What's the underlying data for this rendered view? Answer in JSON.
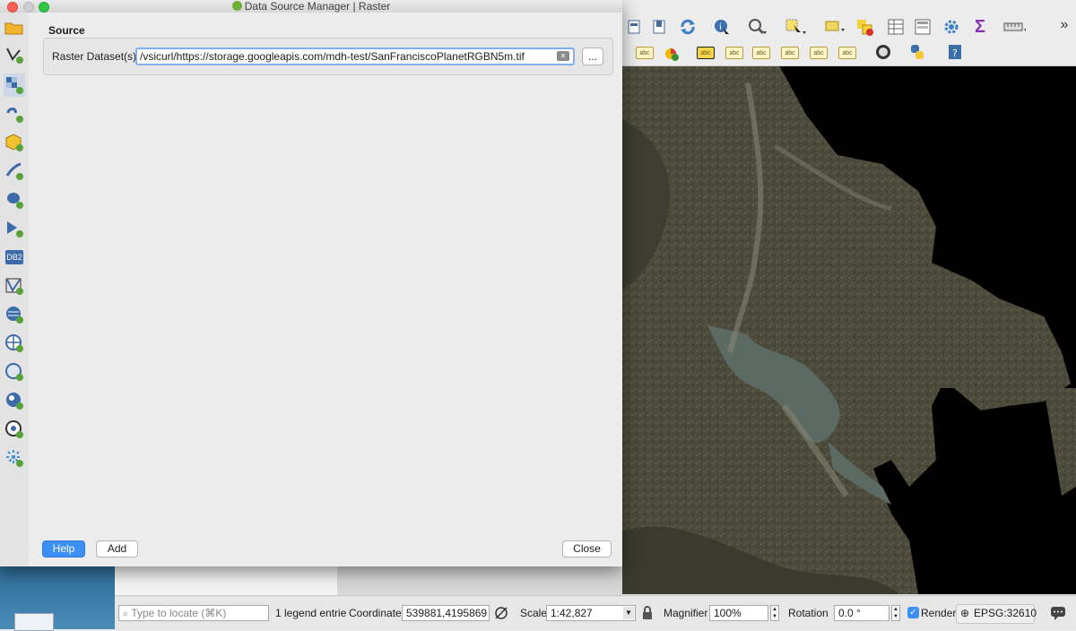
{
  "dialog": {
    "title": "Data Source Manager | Raster",
    "section_title": "Source",
    "raster_label": "Raster Dataset(s)",
    "raster_value": "/vsicurl/https://storage.googleapis.com/mdh-test/SanFranciscoPlanetRGBN5m.tif",
    "browse_label": "...",
    "help_label": "Help",
    "add_label": "Add",
    "close_label": "Close"
  },
  "sidebar": {
    "items": [
      {
        "icon": "folder-open-icon"
      },
      {
        "icon": "add-vector-layer-icon"
      },
      {
        "icon": "add-raster-layer-icon"
      },
      {
        "icon": "add-mesh-layer-icon"
      },
      {
        "icon": "add-geopackage-icon"
      },
      {
        "icon": "add-spatialite-icon"
      },
      {
        "icon": "add-postgis-icon"
      },
      {
        "icon": "add-mssql-icon"
      },
      {
        "icon": "add-db2-icon",
        "text": "DB2"
      },
      {
        "icon": "add-virtual-layer-icon"
      },
      {
        "icon": "add-wms-icon"
      },
      {
        "icon": "add-wcs-icon"
      },
      {
        "icon": "add-wfs-icon"
      },
      {
        "icon": "add-arcgis-map-icon"
      },
      {
        "icon": "add-arcgis-feature-icon"
      },
      {
        "icon": "add-delimited-text-icon"
      }
    ]
  },
  "statusbar": {
    "locate_placeholder": "Type to locate (⌘K)",
    "legend_text": "1 legend entrie",
    "coordinate_label": "Coordinate",
    "coordinate_value": "539881,4195869",
    "scale_label": "Scale",
    "scale_value": "1:42,827",
    "magnifier_label": "Magnifier",
    "magnifier_value": "100%",
    "rotation_label": "Rotation",
    "rotation_value": "0.0 °",
    "render_label": "Render",
    "render_checked": true,
    "crs_label": "EPSG:32610"
  },
  "toolbar": {
    "more_label": "»",
    "label_abc": "abc"
  },
  "colors": {
    "accent": "#3c8ff5",
    "map_background": "#000000",
    "water": "#5f6f68",
    "land": "#4a4b3c"
  }
}
